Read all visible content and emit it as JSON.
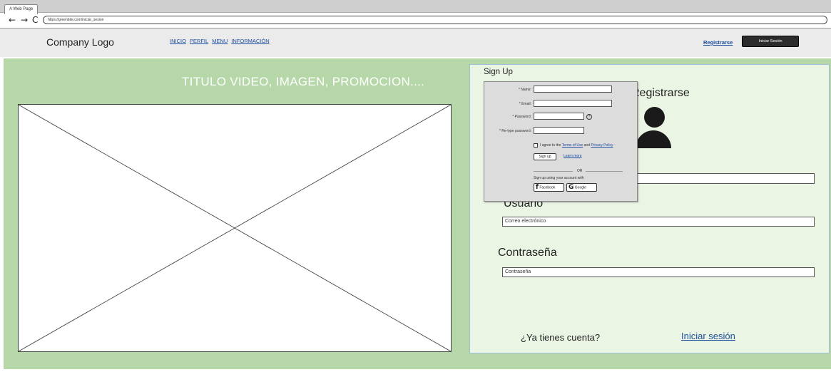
{
  "browser": {
    "tab_title": "A Web Page",
    "url": "https://greenbite.com/iniciar_sesion",
    "back": "←",
    "forward": "→",
    "reload": "C"
  },
  "header": {
    "logo": "Company Logo",
    "nav": [
      "INICIO",
      "PERFIL",
      "MENU",
      "INFORMACIÓN"
    ],
    "register_link": "Registrarse",
    "login_button": "Iniciar Sesión"
  },
  "hero": {
    "title": "TITULO VIDEO, IMAGEN, PROMOCION...."
  },
  "panel": {
    "title": "Sign Up",
    "heading": "Registrarse",
    "user_label": "Usuario",
    "email_placeholder": "Correo electrónico",
    "password_label": "Contraseña",
    "password_placeholder": "Contraseña",
    "have_account": "¿Ya tienes cuenta?",
    "login_link": "Iniciar sesión"
  },
  "signup_popup": {
    "name_label": "* Name:",
    "email_label": "* Email:",
    "password_label": "* Password:",
    "retype_label": "* Re-type password:",
    "help": "?",
    "agree_prefix": "I agree to the",
    "terms": "Terms of Use",
    "and": "and",
    "privacy": "Privacy Policy",
    "signup_button": "Sign up",
    "learn_more": "Learn more",
    "or": "OR",
    "signup_using": "Sign up using your account with",
    "facebook": "Facebook",
    "google": "Google",
    "facebook_icon": "f",
    "google_icon": "G"
  }
}
